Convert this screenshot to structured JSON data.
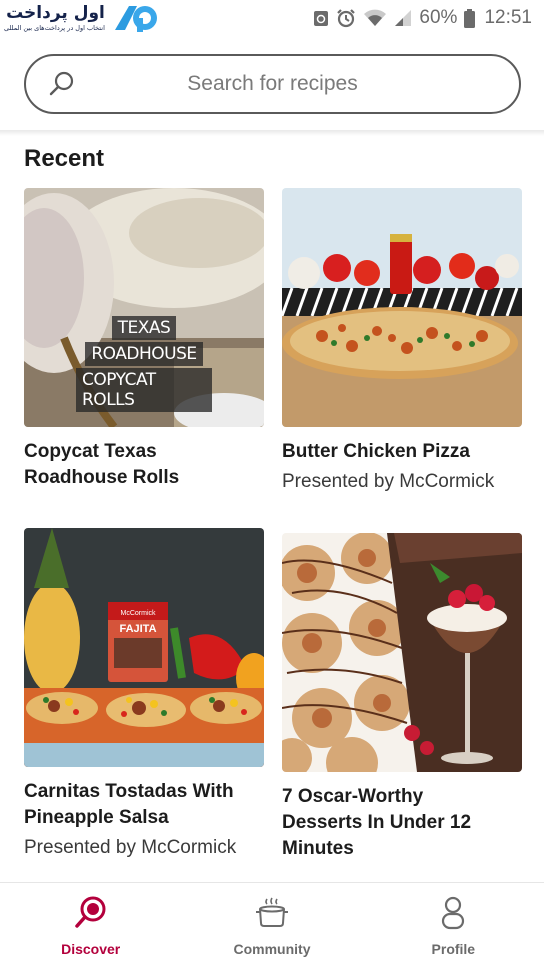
{
  "status_bar": {
    "brand_main": "اول پرداخت",
    "brand_sub": "انتخاب اول در پرداخت‌های بین المللی",
    "battery": "60%",
    "time": "12:51"
  },
  "search": {
    "placeholder": "Search for recipes"
  },
  "section": {
    "title": "Recent"
  },
  "cards": [
    {
      "title_line1": "Copycat Texas",
      "title_line2": "Roadhouse Rolls",
      "subtitle": "",
      "overlay": [
        "TEXAS",
        "ROADHOUSE",
        "COPYCAT ROLLS"
      ]
    },
    {
      "title_line1": "Butter Chicken Pizza",
      "title_line2": "",
      "subtitle": "Presented by McCormick",
      "jar_label": "paprika"
    },
    {
      "title_line1": "Carnitas Tostadas With",
      "title_line2": "Pineapple Salsa",
      "subtitle": "Presented by McCormick",
      "packet_brand": "McCormick",
      "packet_label": "FAJITA"
    },
    {
      "title_line1": "7 Oscar-Worthy",
      "title_line2": "Desserts In Under 12",
      "title_line3": "Minutes",
      "subtitle": ""
    }
  ],
  "nav": {
    "items": [
      {
        "label": "Discover",
        "icon": "search-icon",
        "active": true
      },
      {
        "label": "Community",
        "icon": "cooking-pot-icon",
        "active": false
      },
      {
        "label": "Profile",
        "icon": "person-icon",
        "active": false
      }
    ]
  },
  "colors": {
    "accent": "#b3003c",
    "inactive": "#6b6b6b",
    "text": "#1c1c1c"
  }
}
